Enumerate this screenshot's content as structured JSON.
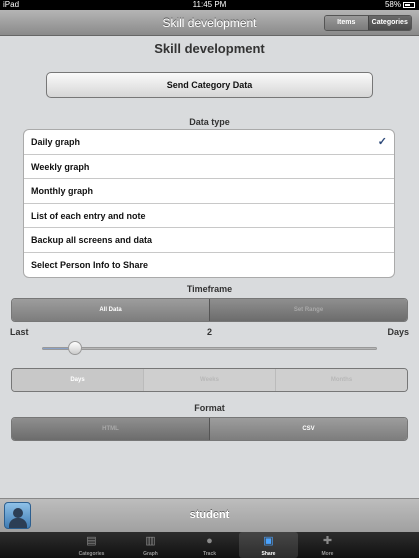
{
  "status": {
    "left": "iPad",
    "time": "11:45 PM",
    "battery": "58%"
  },
  "nav": {
    "title": "Skill development",
    "segments": [
      "Items",
      "Categories"
    ]
  },
  "page_title": "Skill development",
  "send_button": "Send Category Data",
  "data_type": {
    "label": "Data type",
    "rows": [
      "Daily graph",
      "Weekly graph",
      "Monthly graph",
      "List of each entry and note",
      "Backup all screens and data",
      "Select Person Info to Share"
    ],
    "checkmark": "✓"
  },
  "timeframe": {
    "label": "Timeframe",
    "segments": [
      "All Data",
      "Set Range"
    ],
    "range_left": "Last",
    "range_value": "2",
    "range_right": "Days",
    "slider_value": 2,
    "units": [
      "Days",
      "Weeks",
      "Months"
    ]
  },
  "format": {
    "label": "Format",
    "segments": [
      "HTML",
      "CSV"
    ]
  },
  "person": {
    "name": "student"
  },
  "tabs": [
    {
      "label": "Categories",
      "icon": "categories-icon"
    },
    {
      "label": "Graph",
      "icon": "graph-icon"
    },
    {
      "label": "Track",
      "icon": "track-paw-icon"
    },
    {
      "label": "Share",
      "icon": "share-speech-icon"
    },
    {
      "label": "More",
      "icon": "more-puzzle-icon"
    }
  ]
}
